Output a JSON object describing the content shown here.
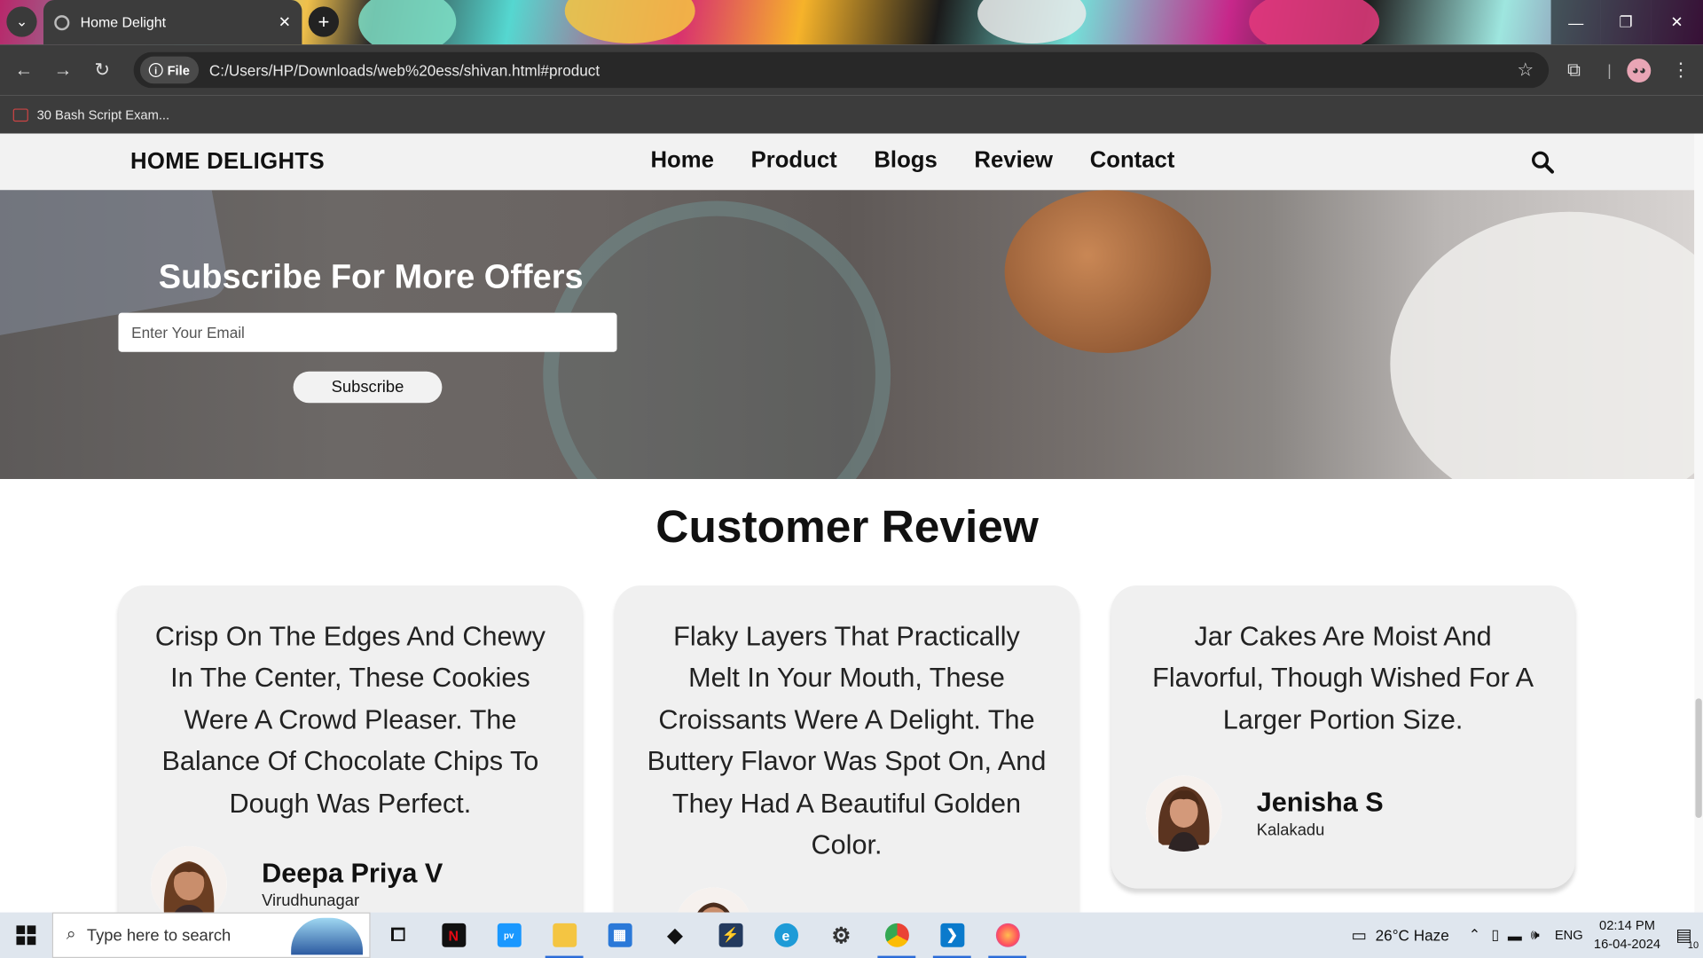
{
  "browser": {
    "tab_title": "Home Delight",
    "url_chip": "File",
    "url": "C:/Users/HP/Downloads/web%20ess/shivan.html#product",
    "bookmark": "30 Bash Script Exam..."
  },
  "site": {
    "logo": "HOME DELIGHTS",
    "nav": [
      "Home",
      "Product",
      "Blogs",
      "Review",
      "Contact"
    ]
  },
  "hero": {
    "title": "Subscribe For More Offers",
    "email_placeholder": "Enter Your Email",
    "button": "Subscribe"
  },
  "reviews": {
    "title": "Customer Review",
    "items": [
      {
        "quote": "Crisp On The Edges And Chewy In The Center, These Cookies Were A Crowd Pleaser. The Balance Of Chocolate Chips To Dough Was Perfect.",
        "name": "Deepa Priya V",
        "location": "Virudhunagar"
      },
      {
        "quote": "Flaky Layers That Practically Melt In Your Mouth, These Croissants Were A Delight. The Buttery Flavor Was Spot On, And They Had A Beautiful Golden Color.",
        "name": "",
        "location": ""
      },
      {
        "quote": "Jar Cakes Are Moist And Flavorful, Though Wished For A Larger Portion Size.",
        "name": "Jenisha S",
        "location": "Kalakadu"
      }
    ]
  },
  "taskbar": {
    "search_placeholder": "Type here to search",
    "weather": "26°C  Haze",
    "lang": "ENG",
    "time": "02:14 PM",
    "date": "16-04-2024",
    "notifications": "10"
  },
  "colors": {
    "header_bg": "#f2f2f2",
    "card_bg": "#f0f0f0",
    "chrome_bg": "#3c3c3c"
  }
}
